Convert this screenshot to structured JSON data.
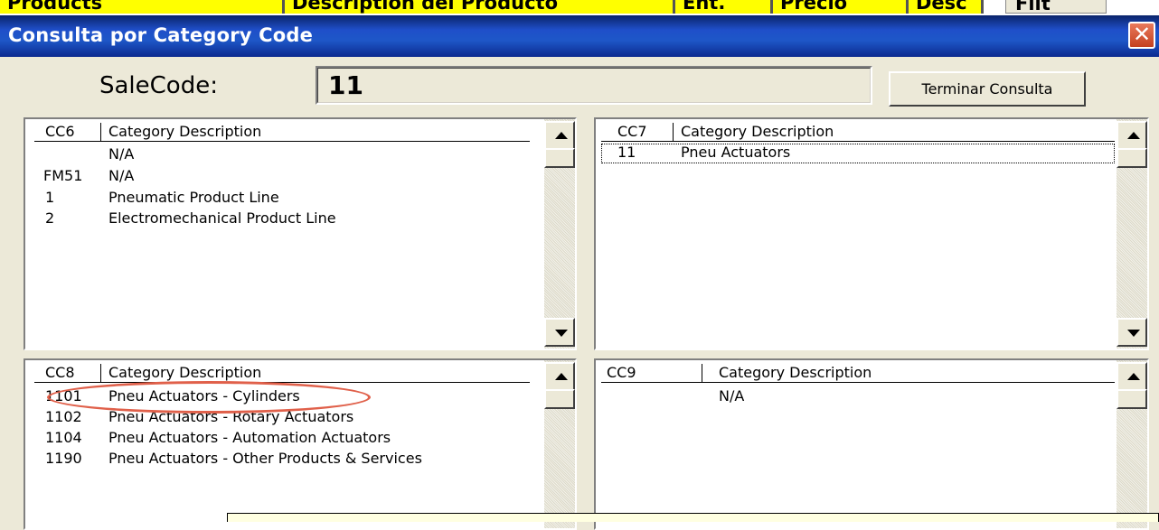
{
  "background_sheet": {
    "cells": [
      "Products",
      "Description del Producto",
      "Ent.",
      "Precio",
      "Desc",
      "Filt"
    ]
  },
  "window": {
    "title": "Consulta  por  Category Code",
    "close_icon": "close-icon"
  },
  "salecode": {
    "label": "SaleCode:",
    "value": "11"
  },
  "buttons": {
    "terminar": "Terminar Consulta"
  },
  "lists": {
    "cc6": {
      "code_header": "CC6",
      "desc_header": "Category Description",
      "rows": [
        {
          "code": "",
          "desc": "N/A"
        },
        {
          "code": "FM51",
          "desc": "N/A"
        },
        {
          "code": "1",
          "desc": "Pneumatic Product Line"
        },
        {
          "code": "2",
          "desc": "Electromechanical Product Line"
        }
      ]
    },
    "cc7": {
      "code_header": "CC7",
      "desc_header": "Category Description",
      "rows": [
        {
          "code": "11",
          "desc": "Pneu Actuators"
        }
      ]
    },
    "cc8": {
      "code_header": "CC8",
      "desc_header": "Category Description",
      "rows": [
        {
          "code": "1101",
          "desc": "Pneu Actuators - Cylinders"
        },
        {
          "code": "1102",
          "desc": "Pneu Actuators - Rotary Actuators"
        },
        {
          "code": "1104",
          "desc": "Pneu Actuators - Automation Actuators"
        },
        {
          "code": "1190",
          "desc": "Pneu Actuators - Other Products & Services"
        }
      ]
    },
    "cc9": {
      "code_header": "CC9",
      "desc_header": "Category Description",
      "rows": [
        {
          "code": "",
          "desc": "N/A"
        }
      ]
    }
  },
  "annotation": {
    "highlight_color": "#e0604a"
  },
  "colors": {
    "titlebar": "#1f4fc9",
    "dialog_bg": "#ece9d8",
    "sheet_highlight": "#ffff00"
  }
}
